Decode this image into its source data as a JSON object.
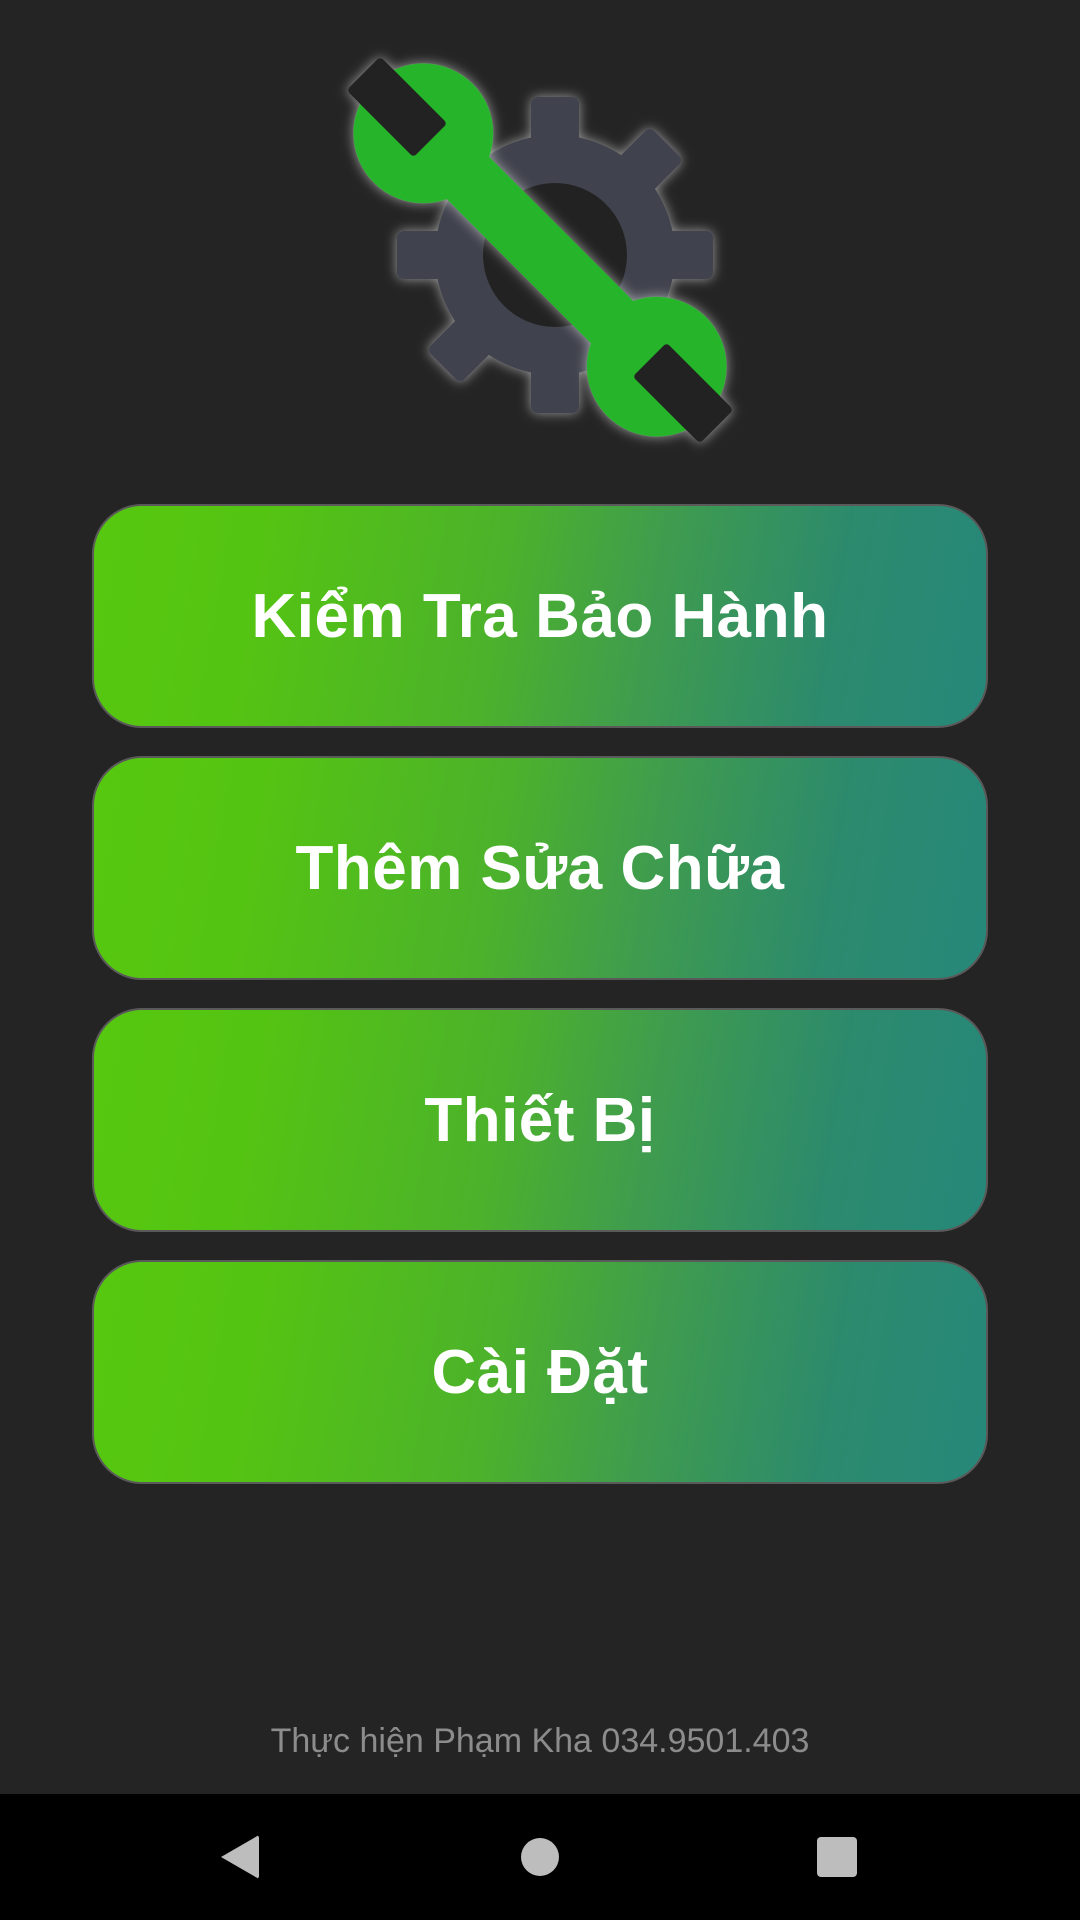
{
  "logo": {
    "icon": "wrench-gear-icon",
    "gear_color": "#41434d",
    "wrench_color": "#25b42a"
  },
  "menu": {
    "items": [
      {
        "label": "Kiểm Tra Bảo Hành"
      },
      {
        "label": "Thêm Sửa Chữa"
      },
      {
        "label": "Thiết Bị"
      },
      {
        "label": "Cài Đặt"
      }
    ]
  },
  "colors": {
    "background": "#242424",
    "button_gradient_start": "#57c810",
    "button_gradient_end": "#26887a",
    "button_text": "#ffffff"
  },
  "footer": {
    "credit": "Thực hiện Phạm Kha 034.9501.403"
  },
  "navbar": {
    "back_icon": "back-triangle-icon",
    "home_icon": "home-circle-icon",
    "recents_icon": "recents-square-icon"
  }
}
